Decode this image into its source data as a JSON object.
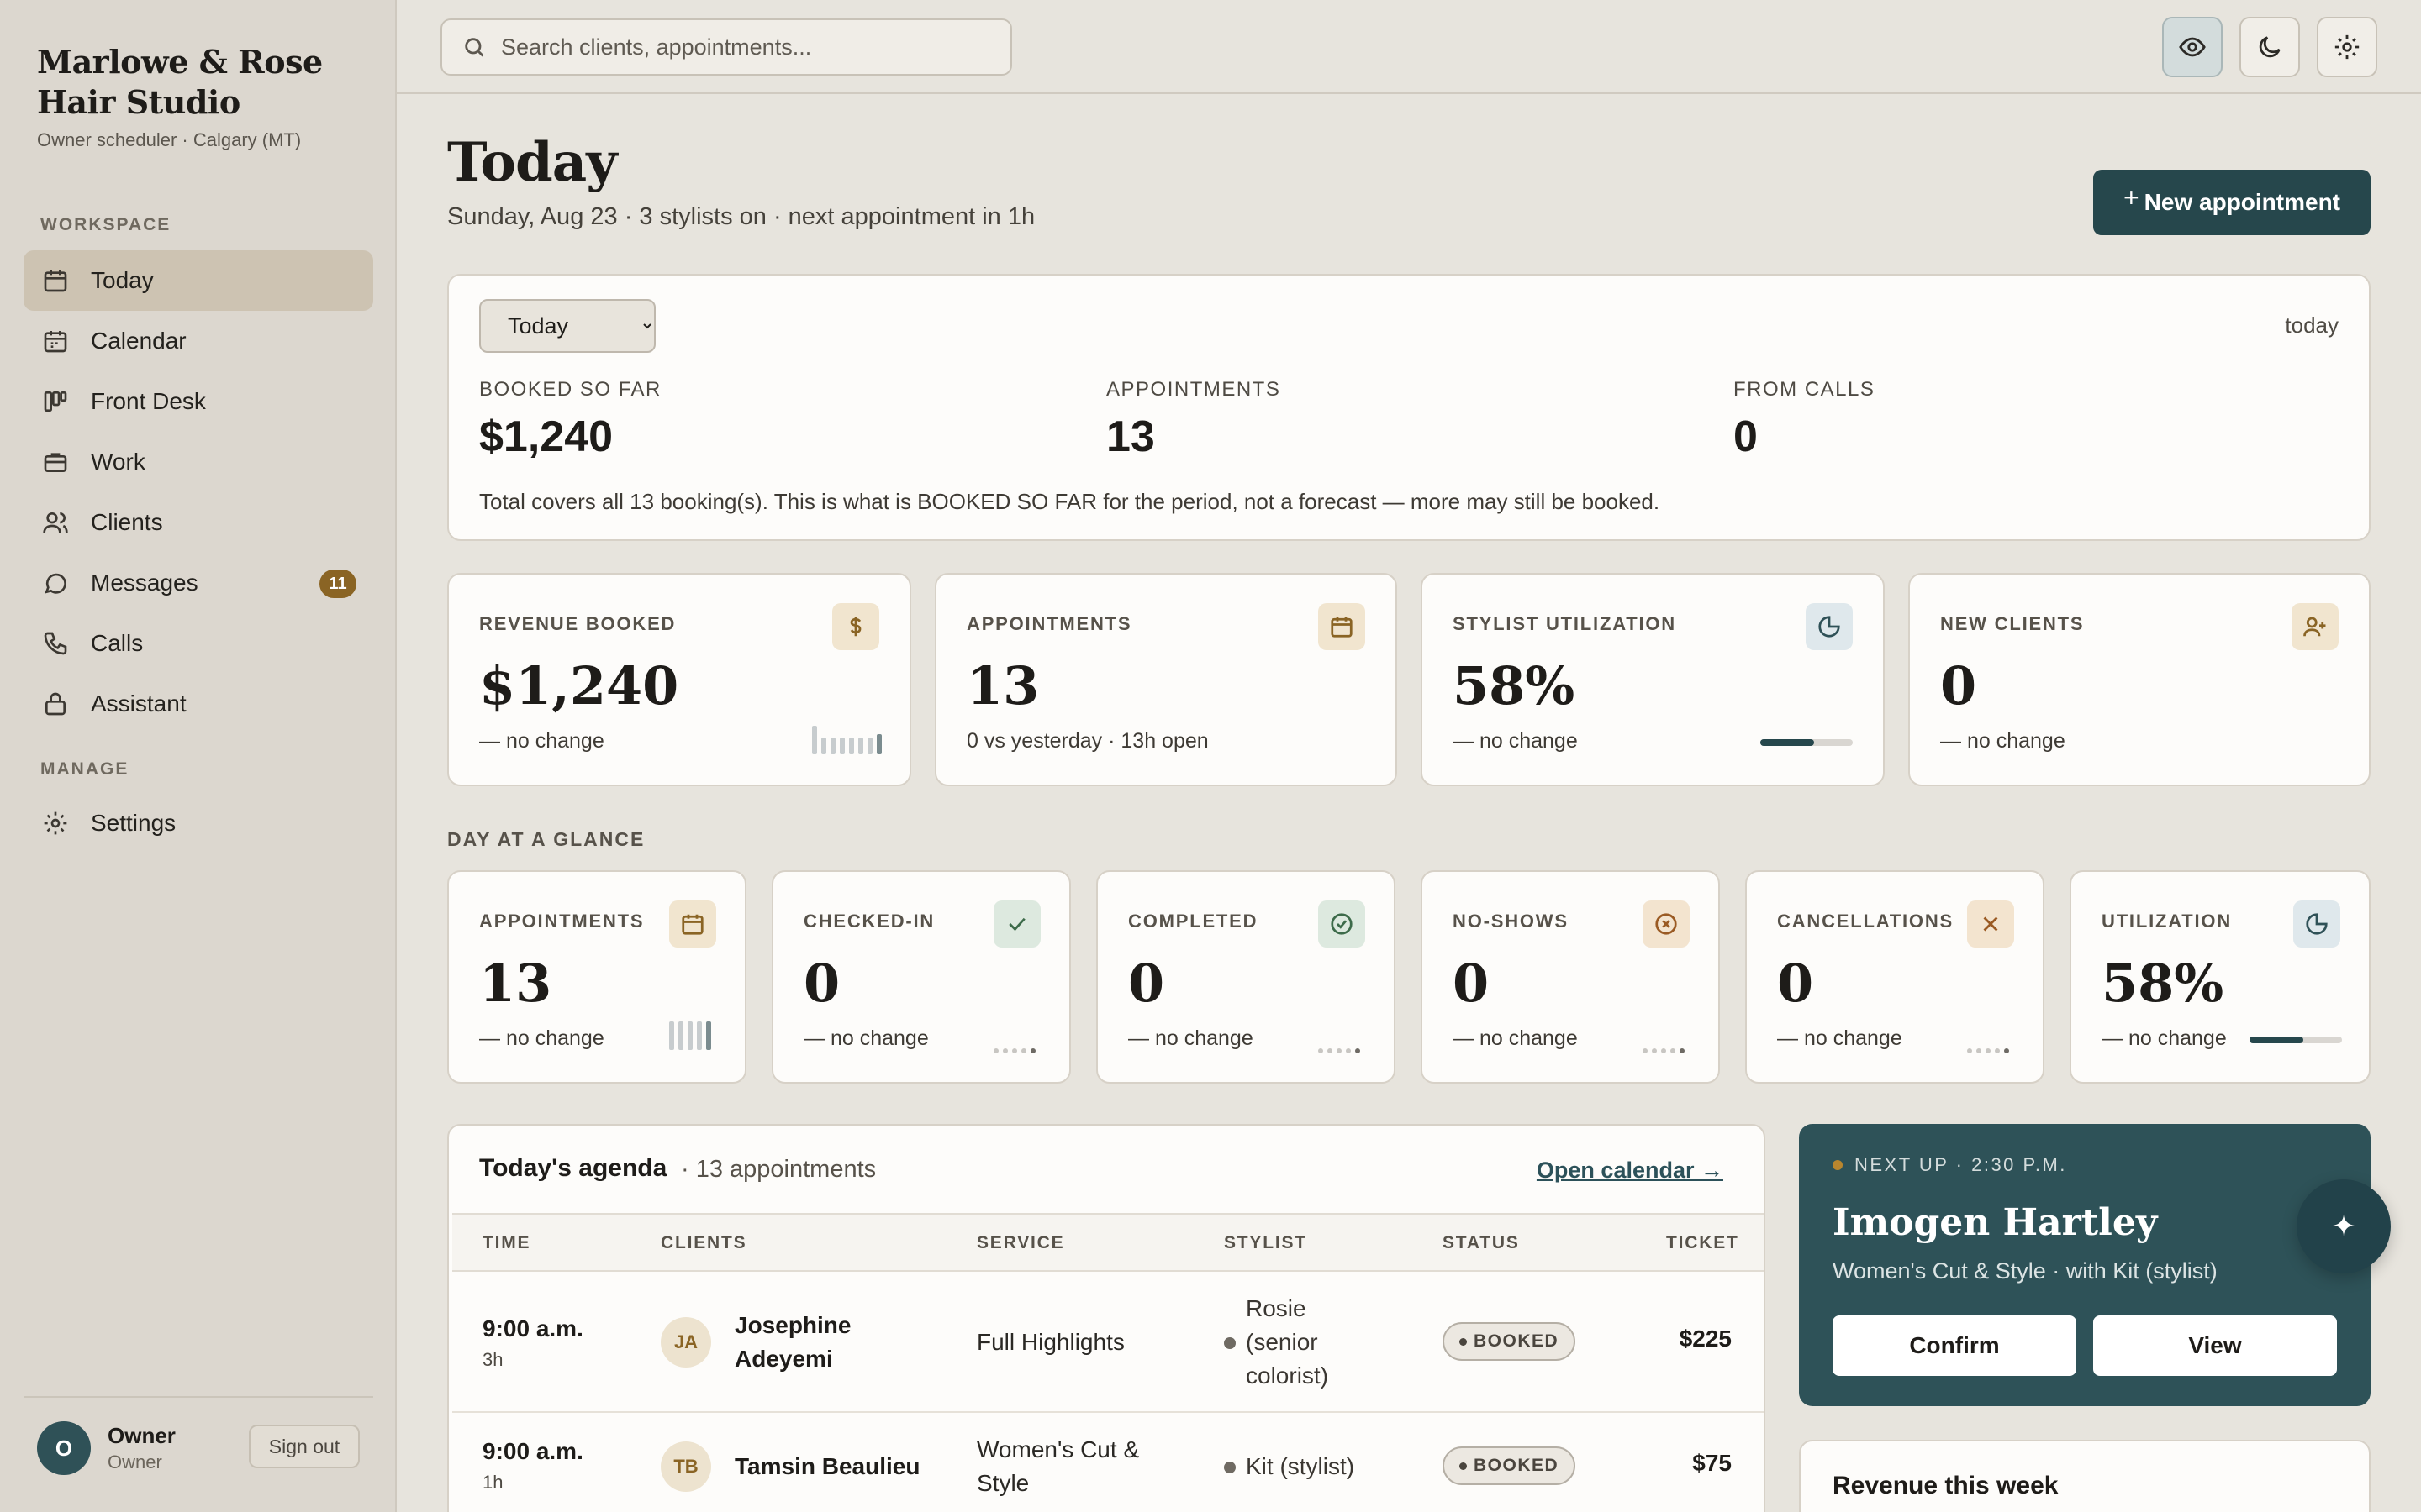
{
  "brand": {
    "title": "Marlowe & Rose Hair Studio",
    "subtitle": "Owner scheduler · Calgary (MT)"
  },
  "sidebar": {
    "workspace_label": "WORKSPACE",
    "manage_label": "MANAGE",
    "items": [
      {
        "label": "Today",
        "icon": "calendar-icon",
        "active": true
      },
      {
        "label": "Calendar",
        "icon": "calendar-grid-icon"
      },
      {
        "label": "Front Desk",
        "icon": "kanban-icon"
      },
      {
        "label": "Work",
        "icon": "briefcase-icon"
      },
      {
        "label": "Clients",
        "icon": "users-icon"
      },
      {
        "label": "Messages",
        "icon": "message-icon",
        "badge": "11"
      },
      {
        "label": "Calls",
        "icon": "phone-icon"
      },
      {
        "label": "Assistant",
        "icon": "lock-icon"
      }
    ],
    "manage_items": [
      {
        "label": "Settings",
        "icon": "gear-icon"
      }
    ],
    "user": {
      "initial": "O",
      "name": "Owner",
      "role": "Owner",
      "signout": "Sign out"
    }
  },
  "topbar": {
    "search_placeholder": "Search clients, appointments...",
    "buttons": [
      "eye-icon",
      "moon-icon",
      "gear-icon"
    ]
  },
  "page": {
    "title": "Today",
    "subtitle": "Sunday, Aug 23 · 3 stylists on · next appointment in 1h",
    "new_button": "New appointment"
  },
  "summary": {
    "period_options": [
      "Today"
    ],
    "period_selected": "Today",
    "period_tag": "today",
    "stats": [
      {
        "label": "BOOKED SO FAR",
        "value": "$1,240"
      },
      {
        "label": "APPOINTMENTS",
        "value": "13"
      },
      {
        "label": "FROM CALLS",
        "value": "0"
      }
    ],
    "note": "Total covers all 13 booking(s). This is what is BOOKED SO FAR for the period, not a forecast — more may still be booked."
  },
  "kpis": [
    {
      "label": "REVENUE BOOKED",
      "value": "$1,240",
      "delta": "— no change",
      "icon": "dollar-icon"
    },
    {
      "label": "APPOINTMENTS",
      "value": "13",
      "delta": "0 vs yesterday · 13h open",
      "icon": "calendar-icon"
    },
    {
      "label": "STYLIST UTILIZATION",
      "value": "58%",
      "delta": "— no change",
      "icon": "pie-icon",
      "progress": 0.58
    },
    {
      "label": "NEW CLIENTS",
      "value": "0",
      "delta": "— no change",
      "icon": "user-plus-icon"
    }
  ],
  "glance": {
    "label": "DAY AT A GLANCE",
    "cards": [
      {
        "label": "APPOINTMENTS",
        "value": "13",
        "delta": "— no change",
        "icon": "calendar-icon"
      },
      {
        "label": "CHECKED-IN",
        "value": "0",
        "delta": "— no change",
        "icon": "check-icon"
      },
      {
        "label": "COMPLETED",
        "value": "0",
        "delta": "— no change",
        "icon": "check-circle-icon"
      },
      {
        "label": "NO-SHOWS",
        "value": "0",
        "delta": "— no change",
        "icon": "x-circle-icon"
      },
      {
        "label": "CANCELLATIONS",
        "value": "0",
        "delta": "— no change",
        "icon": "x-icon"
      },
      {
        "label": "UTILIZATION",
        "value": "58%",
        "delta": "— no change",
        "icon": "pie-icon",
        "progress": 0.58
      }
    ]
  },
  "agenda": {
    "title": "Today's agenda",
    "count": "· 13 appointments",
    "link": "Open calendar →",
    "columns": [
      "TIME",
      "CLIENTS",
      "SERVICE",
      "STYLIST",
      "STATUS",
      "TICKET"
    ],
    "rows": [
      {
        "time": "9:00 a.m.",
        "duration": "3h",
        "initials": "JA",
        "client": "Josephine Adeyemi",
        "service": "Full Highlights",
        "stylist": "Rosie (senior colorist)",
        "status": "BOOKED",
        "ticket": "$225"
      },
      {
        "time": "9:00 a.m.",
        "duration": "1h",
        "initials": "TB",
        "client": "Tamsin Beaulieu",
        "service": "Women's Cut & Style",
        "stylist": "Kit (stylist)",
        "status": "BOOKED",
        "ticket": "$75"
      }
    ]
  },
  "next_up": {
    "kicker": "NEXT UP · 2:30 P.M.",
    "name": "Imogen Hartley",
    "detail": "Women's Cut & Style · with Kit (stylist)",
    "confirm": "Confirm",
    "view": "View",
    "fab_glyph": "✦"
  },
  "revenue_week": {
    "title": "Revenue this week"
  },
  "colors": {
    "accent": "#26474c",
    "badge": "#8a6424",
    "background": "#e7e4dd",
    "sidebar": "#dcd7cf"
  }
}
